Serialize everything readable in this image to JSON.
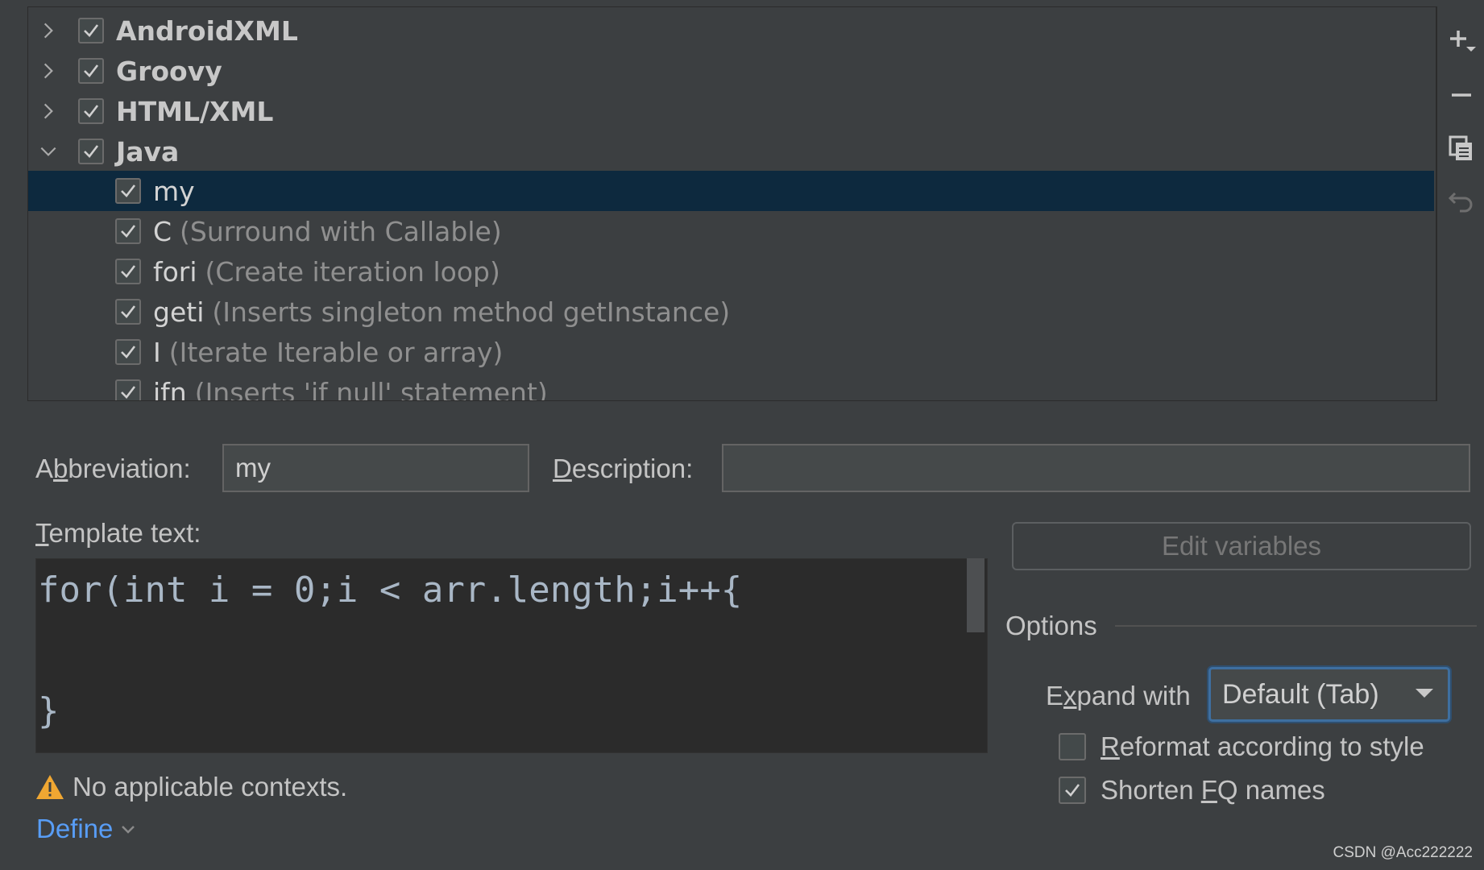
{
  "tree": {
    "groups": [
      {
        "name": "AndroidXML",
        "checked": true,
        "expanded": false
      },
      {
        "name": "Groovy",
        "checked": true,
        "expanded": false
      },
      {
        "name": "HTML/XML",
        "checked": true,
        "expanded": false
      },
      {
        "name": "Java",
        "checked": true,
        "expanded": true
      }
    ],
    "java_items": [
      {
        "abbr": "my",
        "desc": "",
        "checked": true,
        "selected": true
      },
      {
        "abbr": "C",
        "desc": "(Surround with Callable)",
        "checked": true,
        "selected": false
      },
      {
        "abbr": "fori",
        "desc": "(Create iteration loop)",
        "checked": true,
        "selected": false
      },
      {
        "abbr": "geti",
        "desc": "(Inserts singleton method getInstance)",
        "checked": true,
        "selected": false
      },
      {
        "abbr": "I",
        "desc": "(Iterate Iterable or array)",
        "checked": true,
        "selected": false
      },
      {
        "abbr": "ifn",
        "desc": "(Inserts 'if null' statement)",
        "checked": true,
        "selected": false
      }
    ]
  },
  "toolbar": {
    "icons": [
      "add-icon",
      "remove-icon",
      "copy-icon",
      "restore-icon"
    ]
  },
  "form": {
    "abbreviation_label_pre": "A",
    "abbreviation_label_mnemonic": "b",
    "abbreviation_label_post": "breviation:",
    "abbreviation_value": "my",
    "description_label_mnemonic": "D",
    "description_label_post": "escription:",
    "description_value": "",
    "template_label_mnemonic": "T",
    "template_label_post": "emplate text:",
    "template_text": "for(int i = 0;i < arr.length;i++{\n\n}",
    "edit_variables_label": "Edit variables"
  },
  "options": {
    "title": "Options",
    "expand_label_pre": "E",
    "expand_label_mnemonic": "x",
    "expand_label_post": "pand with",
    "expand_value": "Default (Tab)",
    "reformat_mnemonic": "R",
    "reformat_post": "eformat according to style",
    "reformat_checked": false,
    "shorten_pre": "Shorten ",
    "shorten_mnemonic": "F",
    "shorten_post": "Q names",
    "shorten_checked": true
  },
  "context": {
    "warning_text": "No applicable contexts.",
    "define_label": "Define"
  },
  "watermark": "CSDN @Acc222222",
  "colors": {
    "background": "#3c3f41",
    "selection": "#0d293e",
    "link": "#589df6",
    "warning": "#f0a732"
  }
}
